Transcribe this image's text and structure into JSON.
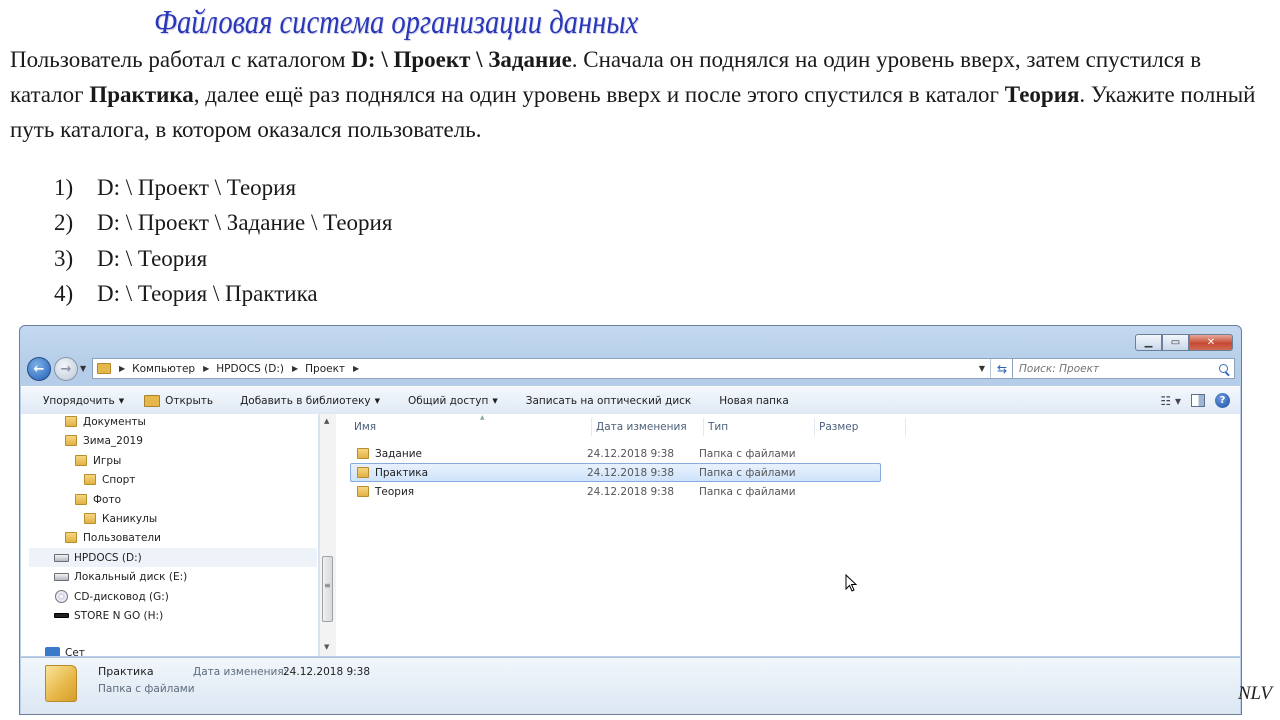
{
  "slide": {
    "title": "Файловая система организации данных",
    "question": {
      "p1": "Пользователь работал с каталогом ",
      "path_start": "D: \\ Проект \\ Задание",
      "p2": ". Сначала он поднялся на один уровень вверх, затем спустился в каталог ",
      "folder_practice": "Практика",
      "p3": ", далее ещё раз поднялся на один уровень вверх и после этого спустился в каталог ",
      "folder_theory": "Теория",
      "p4": ". Укажите полный путь каталога, в котором оказался пользователь."
    },
    "answers": [
      {
        "num": "1)",
        "text": "D: \\ Проект \\ Теория"
      },
      {
        "num": "2)",
        "text": "D: \\ Проект \\ Задание \\ Теория"
      },
      {
        "num": "3)",
        "text": "D: \\ Теория"
      },
      {
        "num": "4)",
        "text": "D: \\ Теория \\ Практика"
      }
    ],
    "signature": "NLV"
  },
  "explorer": {
    "address": {
      "crumbs": [
        "Компьютер",
        "HPDOCS (D:)",
        "Проект"
      ]
    },
    "search": {
      "placeholder": "Поиск: Проект"
    },
    "toolbar": {
      "organize": "Упорядочить",
      "open": "Открыть",
      "add_library": "Добавить в библиотеку",
      "share": "Общий доступ",
      "burn": "Записать на оптический диск",
      "new_folder": "Новая папка"
    },
    "nav_tree": [
      {
        "label": "Документы",
        "icon": "folder"
      },
      {
        "label": "Зима_2019",
        "icon": "folder"
      },
      {
        "label": "Игры",
        "icon": "folder"
      },
      {
        "label": "Спорт",
        "icon": "folder"
      },
      {
        "label": "Фото",
        "icon": "folder"
      },
      {
        "label": "Каникулы",
        "icon": "folder"
      },
      {
        "label": "Пользователи",
        "icon": "folder"
      },
      {
        "label": "HPDOCS (D:)",
        "icon": "drive"
      },
      {
        "label": "Локальный диск (E:)",
        "icon": "drive"
      },
      {
        "label": "CD-дисковод (G:)",
        "icon": "cd"
      },
      {
        "label": "STORE N GO (H:)",
        "icon": "usb-drive"
      }
    ],
    "nav_partial": "Сет",
    "columns": {
      "name": "Имя",
      "date": "Дата изменения",
      "type": "Тип",
      "size": "Размер"
    },
    "files": [
      {
        "name": "Задание",
        "date": "24.12.2018 9:38",
        "type": "Папка с файлами",
        "selected": false
      },
      {
        "name": "Практика",
        "date": "24.12.2018 9:38",
        "type": "Папка с файлами",
        "selected": true
      },
      {
        "name": "Теория",
        "date": "24.12.2018 9:38",
        "type": "Папка с файлами",
        "selected": false
      }
    ],
    "details": {
      "name": "Практика",
      "type": "Папка с файлами",
      "date_label": "Дата изменения:",
      "date": "24.12.2018 9:38"
    }
  }
}
